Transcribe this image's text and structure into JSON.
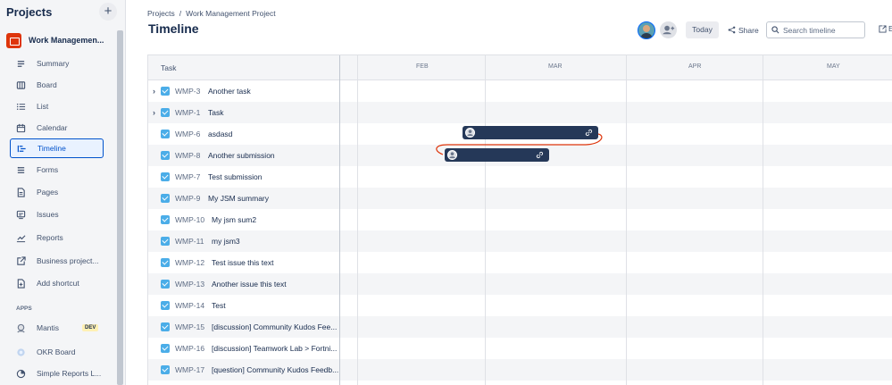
{
  "sidebar": {
    "title": "Projects",
    "add_label": "+",
    "project_name": "Work Managemen...",
    "items": [
      {
        "label": "Summary",
        "icon": "summary-icon"
      },
      {
        "label": "Board",
        "icon": "board-icon"
      },
      {
        "label": "List",
        "icon": "list-icon"
      },
      {
        "label": "Calendar",
        "icon": "calendar-icon"
      },
      {
        "label": "Timeline",
        "icon": "timeline-icon",
        "active": true
      },
      {
        "label": "Forms",
        "icon": "forms-icon"
      },
      {
        "label": "Pages",
        "icon": "pages-icon"
      },
      {
        "label": "Issues",
        "icon": "issues-icon"
      },
      {
        "label": "Reports",
        "icon": "reports-icon"
      },
      {
        "label": "Business project...",
        "icon": "external-link-icon"
      },
      {
        "label": "Add shortcut",
        "icon": "add-shortcut-icon"
      }
    ],
    "apps_label": "APPS",
    "apps": [
      {
        "label": "Mantis",
        "icon": "mantis-icon",
        "badge": "DEV"
      },
      {
        "label": "OKR Board",
        "icon": "okr-icon"
      },
      {
        "label": "Simple Reports L...",
        "icon": "pie-chart-icon"
      }
    ]
  },
  "header": {
    "breadcrumb": [
      "Projects",
      "Work Management Project"
    ],
    "breadcrumb_sep": "/",
    "title": "Timeline",
    "today_label": "Today",
    "share_label": "Share",
    "search_placeholder": "Search timeline",
    "export_label": "E"
  },
  "timeline": {
    "task_header": "Task",
    "months": [
      "FEB",
      "MAR",
      "APR",
      "MAY"
    ],
    "rows": [
      {
        "key": "WMP-3",
        "summary": "Another task",
        "expandable": true
      },
      {
        "key": "WMP-1",
        "summary": "Task",
        "expandable": true
      },
      {
        "key": "WMP-6",
        "summary": "asdasd",
        "expandable": false
      },
      {
        "key": "WMP-8",
        "summary": "Another submission",
        "expandable": false
      },
      {
        "key": "WMP-7",
        "summary": "Test submission",
        "expandable": false
      },
      {
        "key": "WMP-9",
        "summary": "My JSM summary",
        "expandable": false
      },
      {
        "key": "WMP-10",
        "summary": "My jsm sum2",
        "expandable": false
      },
      {
        "key": "WMP-11",
        "summary": "my jsm3",
        "expandable": false
      },
      {
        "key": "WMP-12",
        "summary": "Test issue this text",
        "expandable": false
      },
      {
        "key": "WMP-13",
        "summary": "Another issue this text",
        "expandable": false
      },
      {
        "key": "WMP-14",
        "summary": "Test",
        "expandable": false
      },
      {
        "key": "WMP-15",
        "summary": "[discussion] Community Kudos Fee...",
        "expandable": false
      },
      {
        "key": "WMP-16",
        "summary": "[discussion] Teamwork Lab > Fortni...",
        "expandable": false
      },
      {
        "key": "WMP-17",
        "summary": "[question] Community Kudos Feedb...",
        "expandable": false
      }
    ]
  },
  "colors": {
    "accent": "#0052cc",
    "bar": "#253858",
    "checkbox": "#4bade8",
    "dependency": "#de350b",
    "project_icon": "#de350b"
  }
}
